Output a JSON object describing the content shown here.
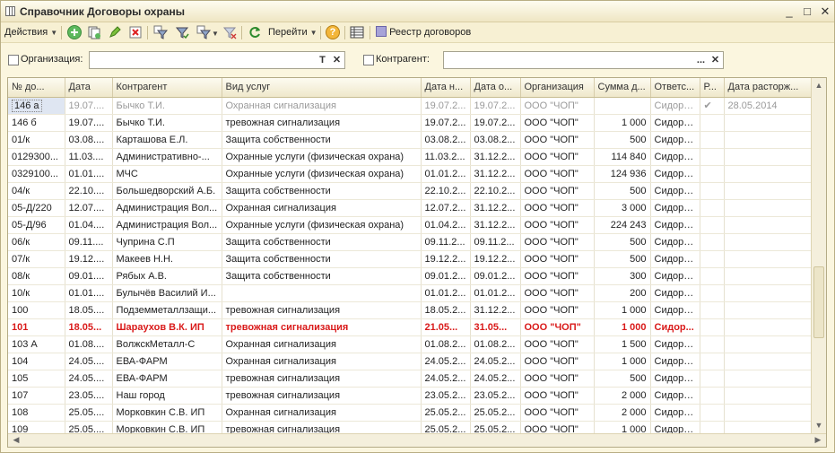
{
  "window": {
    "title": "Справочник Договоры охраны",
    "minimize": "_",
    "maximize": "□",
    "close": "✕"
  },
  "toolbar": {
    "actions_label": "Действия",
    "goto_label": "Перейти",
    "help_label": "?",
    "registry_label": "Реестр договоров"
  },
  "filters": {
    "org_label": "Организация:",
    "org_value": "",
    "org_btn_t": "T",
    "org_btn_x": "✕",
    "contractor_label": "Контрагент:",
    "contractor_value": "",
    "contractor_btn_dots": "...",
    "contractor_btn_x": "✕"
  },
  "columns": [
    "№ до...",
    "Дата",
    "Контрагент",
    "Вид услуг",
    "Дата н...",
    "Дата о...",
    "Организация",
    "Сумма д...",
    "Ответс...",
    "Р...",
    "Дата расторж..."
  ],
  "rows": [
    {
      "c": [
        "146 а",
        "19.07....",
        "Бычко Т.И.",
        "Охранная сигнализация",
        "19.07.2...",
        "19.07.2...",
        "ООО \"ЧОП\"",
        "",
        "Сидоро...",
        "✔",
        "28.05.2014"
      ],
      "style": "selected"
    },
    {
      "c": [
        "146 б",
        "19.07....",
        "Бычко Т.И.",
        "тревожная сигнализация",
        "19.07.2...",
        "19.07.2...",
        "ООО \"ЧОП\"",
        "1 000",
        "Сидоро...",
        "",
        ""
      ],
      "style": ""
    },
    {
      "c": [
        "01/к",
        "03.08....",
        "Карташова Е.Л.",
        "Защита собственности",
        "03.08.2...",
        "03.08.2...",
        "ООО \"ЧОП\"",
        "500",
        "Сидоро...",
        "",
        ""
      ],
      "style": ""
    },
    {
      "c": [
        "0129300...",
        "11.03....",
        "Административно-...",
        "Охранные услуги (физическая охрана)",
        "11.03.2...",
        "31.12.2...",
        "ООО \"ЧОП\"",
        "114 840",
        "Сидоро...",
        "",
        ""
      ],
      "style": ""
    },
    {
      "c": [
        "0329100...",
        "01.01....",
        "МЧС",
        "Охранные услуги (физическая охрана)",
        "01.01.2...",
        "31.12.2...",
        "ООО \"ЧОП\"",
        "124 936",
        "Сидоро...",
        "",
        ""
      ],
      "style": ""
    },
    {
      "c": [
        "04/к",
        "22.10....",
        "Большедворский А.Б.",
        "Защита собственности",
        "22.10.2...",
        "22.10.2...",
        "ООО \"ЧОП\"",
        "500",
        "Сидоро...",
        "",
        ""
      ],
      "style": ""
    },
    {
      "c": [
        "05-Д/220",
        "12.07....",
        "Администрация Вол...",
        "Охранная сигнализация",
        "12.07.2...",
        "31.12.2...",
        "ООО \"ЧОП\"",
        "3 000",
        "Сидоро...",
        "",
        ""
      ],
      "style": ""
    },
    {
      "c": [
        "05-Д/96",
        "01.04....",
        "Администрация Вол...",
        "Охранные услуги (физическая охрана)",
        "01.04.2...",
        "31.12.2...",
        "ООО \"ЧОП\"",
        "224 243",
        "Сидоро...",
        "",
        ""
      ],
      "style": ""
    },
    {
      "c": [
        "06/к",
        "09.11....",
        "Чуприна С.П",
        "Защита собственности",
        "09.11.2...",
        "09.11.2...",
        "ООО \"ЧОП\"",
        "500",
        "Сидоро...",
        "",
        ""
      ],
      "style": ""
    },
    {
      "c": [
        "07/к",
        "19.12....",
        "Макеев Н.Н.",
        "Защита собственности",
        "19.12.2...",
        "19.12.2...",
        "ООО \"ЧОП\"",
        "500",
        "Сидоро...",
        "",
        ""
      ],
      "style": ""
    },
    {
      "c": [
        "08/к",
        "09.01....",
        "Рябых А.В.",
        "Защита собственности",
        "09.01.2...",
        "09.01.2...",
        "ООО \"ЧОП\"",
        "300",
        "Сидоро...",
        "",
        ""
      ],
      "style": ""
    },
    {
      "c": [
        "10/к",
        "01.01....",
        "Булычёв Василий И...",
        "",
        "01.01.2...",
        "01.01.2...",
        "ООО \"ЧОП\"",
        "200",
        "Сидоро...",
        "",
        ""
      ],
      "style": ""
    },
    {
      "c": [
        "100",
        "18.05....",
        "Подземметаллзащи...",
        "тревожная сигнализация",
        "18.05.2...",
        "31.12.2...",
        "ООО \"ЧОП\"",
        "1 000",
        "Сидоро...",
        "",
        ""
      ],
      "style": ""
    },
    {
      "c": [
        "101",
        "18.05...",
        "Шараухов В.К. ИП",
        "тревожная сигнализация",
        "21.05...",
        "31.05...",
        "ООО \"ЧОП\"",
        "1 000",
        "Сидор...",
        "",
        ""
      ],
      "style": "highlight"
    },
    {
      "c": [
        "103 А",
        "01.08....",
        "ВолжскМеталл-С",
        "Охранная сигнализация",
        "01.08.2...",
        "01.08.2...",
        "ООО \"ЧОП\"",
        "1 500",
        "Сидоро...",
        "",
        ""
      ],
      "style": ""
    },
    {
      "c": [
        "104",
        "24.05....",
        "ЕВА-ФАРМ",
        "Охранная сигнализация",
        "24.05.2...",
        "24.05.2...",
        "ООО \"ЧОП\"",
        "1 000",
        "Сидоро...",
        "",
        ""
      ],
      "style": ""
    },
    {
      "c": [
        "105",
        "24.05....",
        "ЕВА-ФАРМ",
        "тревожная сигнализация",
        "24.05.2...",
        "24.05.2...",
        "ООО \"ЧОП\"",
        "500",
        "Сидоро...",
        "",
        ""
      ],
      "style": ""
    },
    {
      "c": [
        "107",
        "23.05....",
        "Наш город",
        "тревожная сигнализация",
        "23.05.2...",
        "23.05.2...",
        "ООО \"ЧОП\"",
        "2 000",
        "Сидоро...",
        "",
        ""
      ],
      "style": ""
    },
    {
      "c": [
        "108",
        "25.05....",
        "Морковкин С.В. ИП",
        "Охранная сигнализация",
        "25.05.2...",
        "25.05.2...",
        "ООО \"ЧОП\"",
        "2 000",
        "Сидоро...",
        "",
        ""
      ],
      "style": ""
    },
    {
      "c": [
        "109",
        "25.05....",
        "Морковкин С.В. ИП",
        "тревожная сигнализация",
        "25.05.2...",
        "25.05.2...",
        "ООО \"ЧОП\"",
        "1 000",
        "Сидоро...",
        "",
        ""
      ],
      "style": ""
    }
  ],
  "colors": {
    "window_bg": "#fbf6df",
    "highlight_text": "#d91a1a",
    "selected_cell": "#dfe6f2"
  }
}
